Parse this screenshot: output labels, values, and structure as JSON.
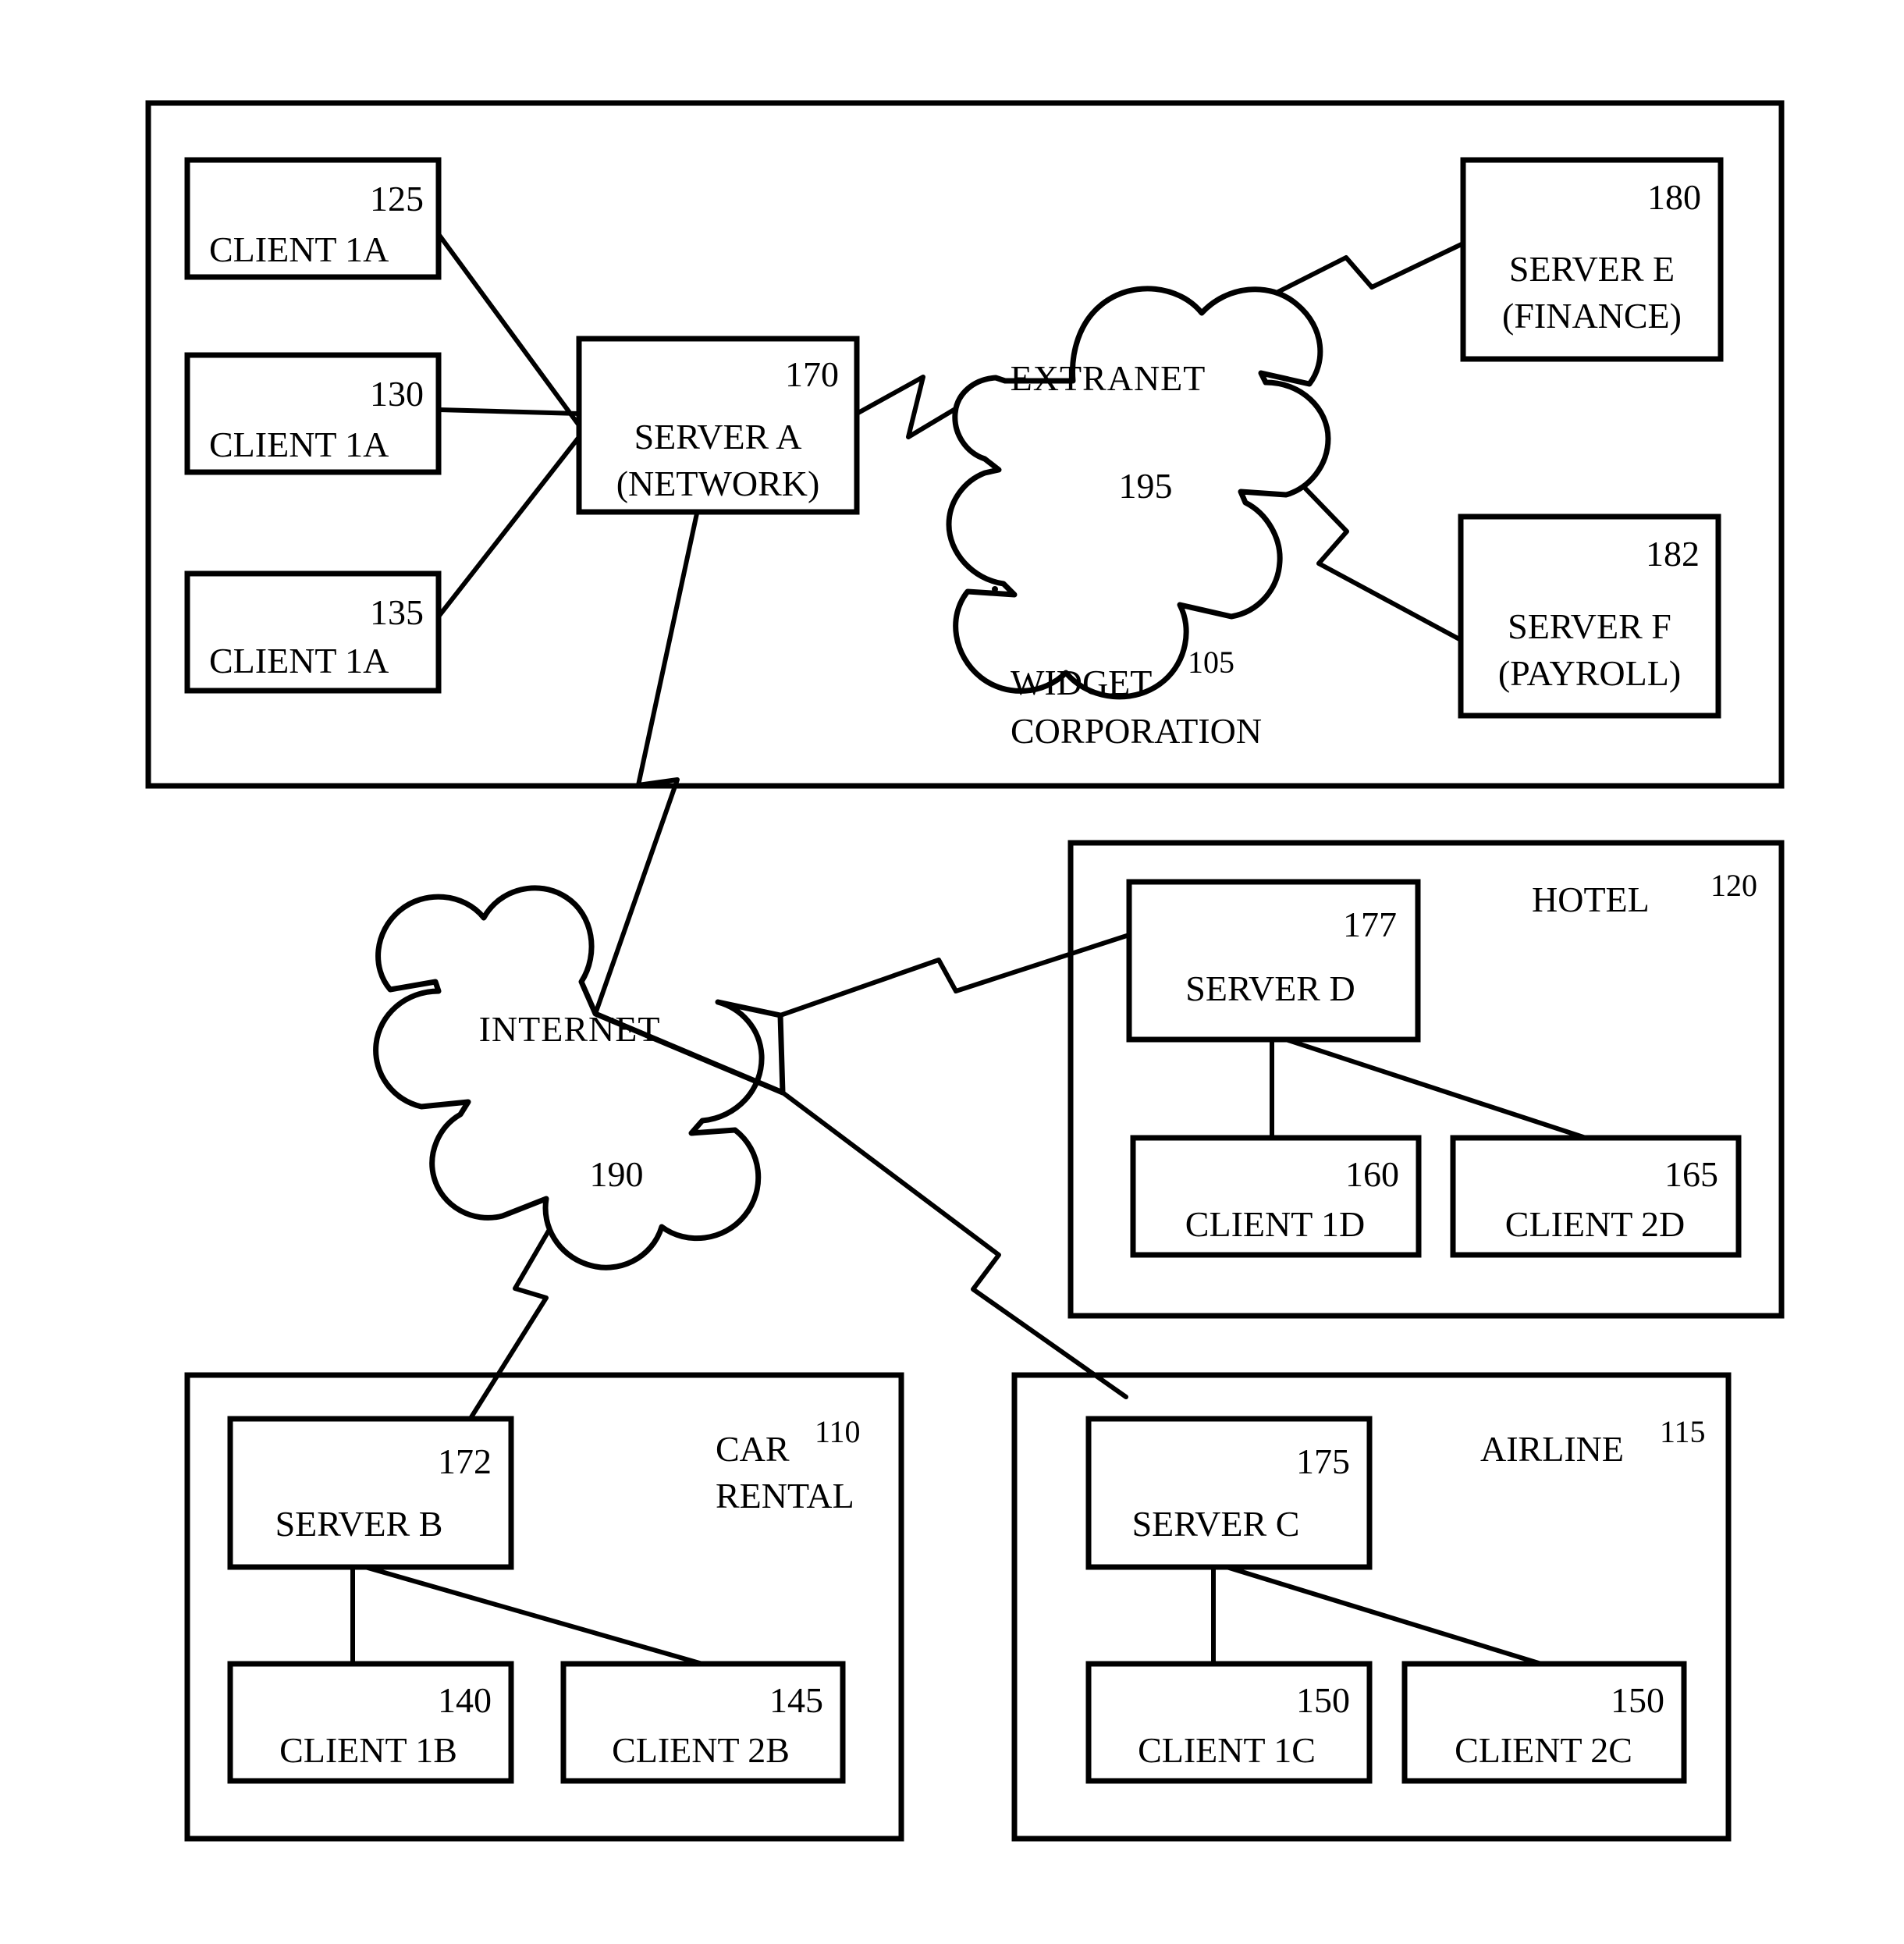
{
  "figure": {
    "type": "network-architecture-diagram",
    "groups": [
      {
        "id": "widget",
        "name_line1": "WIDGET",
        "name_line2": "CORPORATION",
        "ref": "105"
      },
      {
        "id": "hotel",
        "name_line1": "HOTEL",
        "name_line2": "",
        "ref": "120"
      },
      {
        "id": "car-rental",
        "name_line1": "CAR",
        "name_line2": "RENTAL",
        "ref": "110"
      },
      {
        "id": "airline",
        "name_line1": "AIRLINE",
        "name_line2": "",
        "ref": "115"
      }
    ],
    "nodes": [
      {
        "id": "client-1a-125",
        "ref": "125",
        "line1": "CLIENT 1A",
        "line2": ""
      },
      {
        "id": "client-1a-130",
        "ref": "130",
        "line1": "CLIENT 1A",
        "line2": ""
      },
      {
        "id": "client-1a-135",
        "ref": "135",
        "line1": "CLIENT 1A",
        "line2": ""
      },
      {
        "id": "server-a",
        "ref": "170",
        "line1": "SERVER A",
        "line2": "(NETWORK)"
      },
      {
        "id": "server-e",
        "ref": "180",
        "line1": "SERVER E",
        "line2": "(FINANCE)"
      },
      {
        "id": "server-f",
        "ref": "182",
        "line1": "SERVER F",
        "line2": "(PAYROLL)"
      },
      {
        "id": "server-d",
        "ref": "177",
        "line1": "SERVER D",
        "line2": ""
      },
      {
        "id": "client-1d",
        "ref": "160",
        "line1": "CLIENT 1D",
        "line2": ""
      },
      {
        "id": "client-2d",
        "ref": "165",
        "line1": "CLIENT 2D",
        "line2": ""
      },
      {
        "id": "server-b",
        "ref": "172",
        "line1": "SERVER B",
        "line2": ""
      },
      {
        "id": "client-1b",
        "ref": "140",
        "line1": "CLIENT 1B",
        "line2": ""
      },
      {
        "id": "client-2b",
        "ref": "145",
        "line1": "CLIENT 2B",
        "line2": ""
      },
      {
        "id": "server-c",
        "ref": "175",
        "line1": "SERVER C",
        "line2": ""
      },
      {
        "id": "client-1c",
        "ref": "150",
        "line1": "CLIENT 1C",
        "line2": ""
      },
      {
        "id": "client-2c",
        "ref": "150",
        "line1": "CLIENT 2C",
        "line2": ""
      }
    ],
    "clouds": [
      {
        "id": "extranet",
        "label": "EXTRANET",
        "ref": "195"
      },
      {
        "id": "internet",
        "label": "INTERNET",
        "ref": "190"
      }
    ],
    "colors": {
      "stroke": "#000000",
      "fill": "#ffffff",
      "background": "#ffffff"
    }
  }
}
